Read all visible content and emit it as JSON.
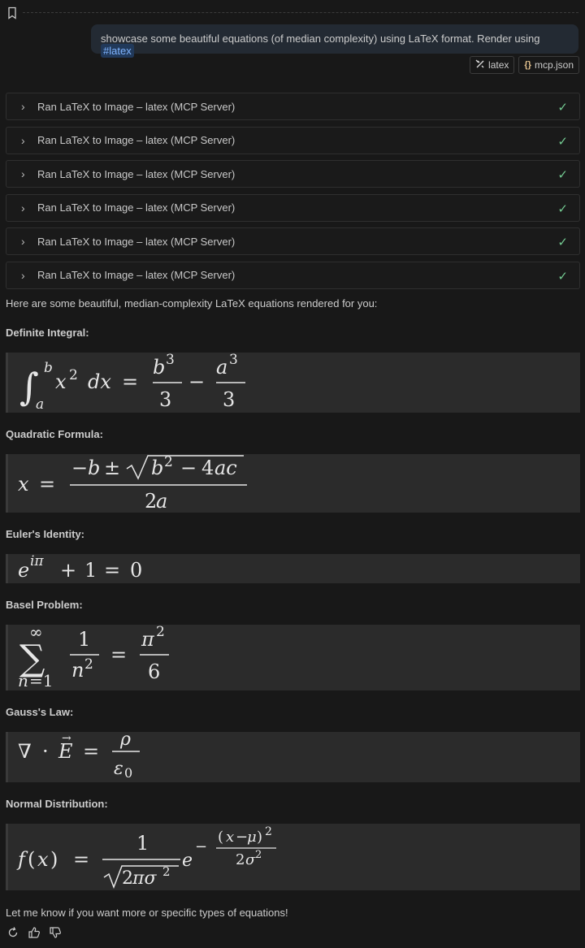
{
  "user_message": {
    "text": "showcase some beautiful equations (of median complexity) using LaTeX format. Render using ",
    "tag": "#latex"
  },
  "attachments": [
    {
      "label": "latex"
    },
    {
      "label": "mcp.json"
    }
  ],
  "tool_calls": [
    {
      "label": "Ran LaTeX to Image – latex (MCP Server)"
    },
    {
      "label": "Ran LaTeX to Image – latex (MCP Server)"
    },
    {
      "label": "Ran LaTeX to Image – latex (MCP Server)"
    },
    {
      "label": "Ran LaTeX to Image – latex (MCP Server)"
    },
    {
      "label": "Ran LaTeX to Image – latex (MCP Server)"
    },
    {
      "label": "Ran LaTeX to Image – latex (MCP Server)"
    }
  ],
  "response": {
    "intro": "Here are some beautiful, median-complexity LaTeX equations rendered for you:",
    "sections": [
      {
        "heading": "Definite Integral:"
      },
      {
        "heading": "Quadratic Formula:"
      },
      {
        "heading": "Euler's Identity:"
      },
      {
        "heading": "Basel Problem:"
      },
      {
        "heading": "Gauss's Law:"
      },
      {
        "heading": "Normal Distribution:"
      }
    ],
    "outro": "Let me know if you want more or specific types of equations!"
  },
  "colors": {
    "background": "#181818",
    "bubble": "#232a33",
    "equation_bg": "#2b2b2b",
    "check": "#73c991",
    "tag": "#7fb4ff"
  }
}
